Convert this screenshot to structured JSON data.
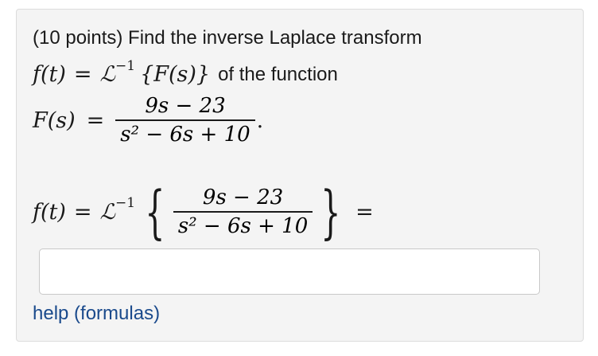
{
  "problem": {
    "prompt": "(10 points) Find the inverse Laplace transform",
    "line2_lhs": "f(t)",
    "line2_eq": "=",
    "line2_op": "ℒ",
    "line2_sup": "−1",
    "line2_arg": "{F(s)}",
    "line2_text": "of the function",
    "F_lhs": "F(s)",
    "F_eq": "=",
    "numerator": "9s − 23",
    "denominator": "s² − 6s + 10",
    "period": ".",
    "f_lhs": "f(t)",
    "f_eq": "=",
    "f_op": "ℒ",
    "f_sup": "−1",
    "brace_open": "{",
    "brace_close": "}",
    "f_rhs": "="
  },
  "answer": {
    "value": "",
    "placeholder": ""
  },
  "help_link": "help (formulas)"
}
